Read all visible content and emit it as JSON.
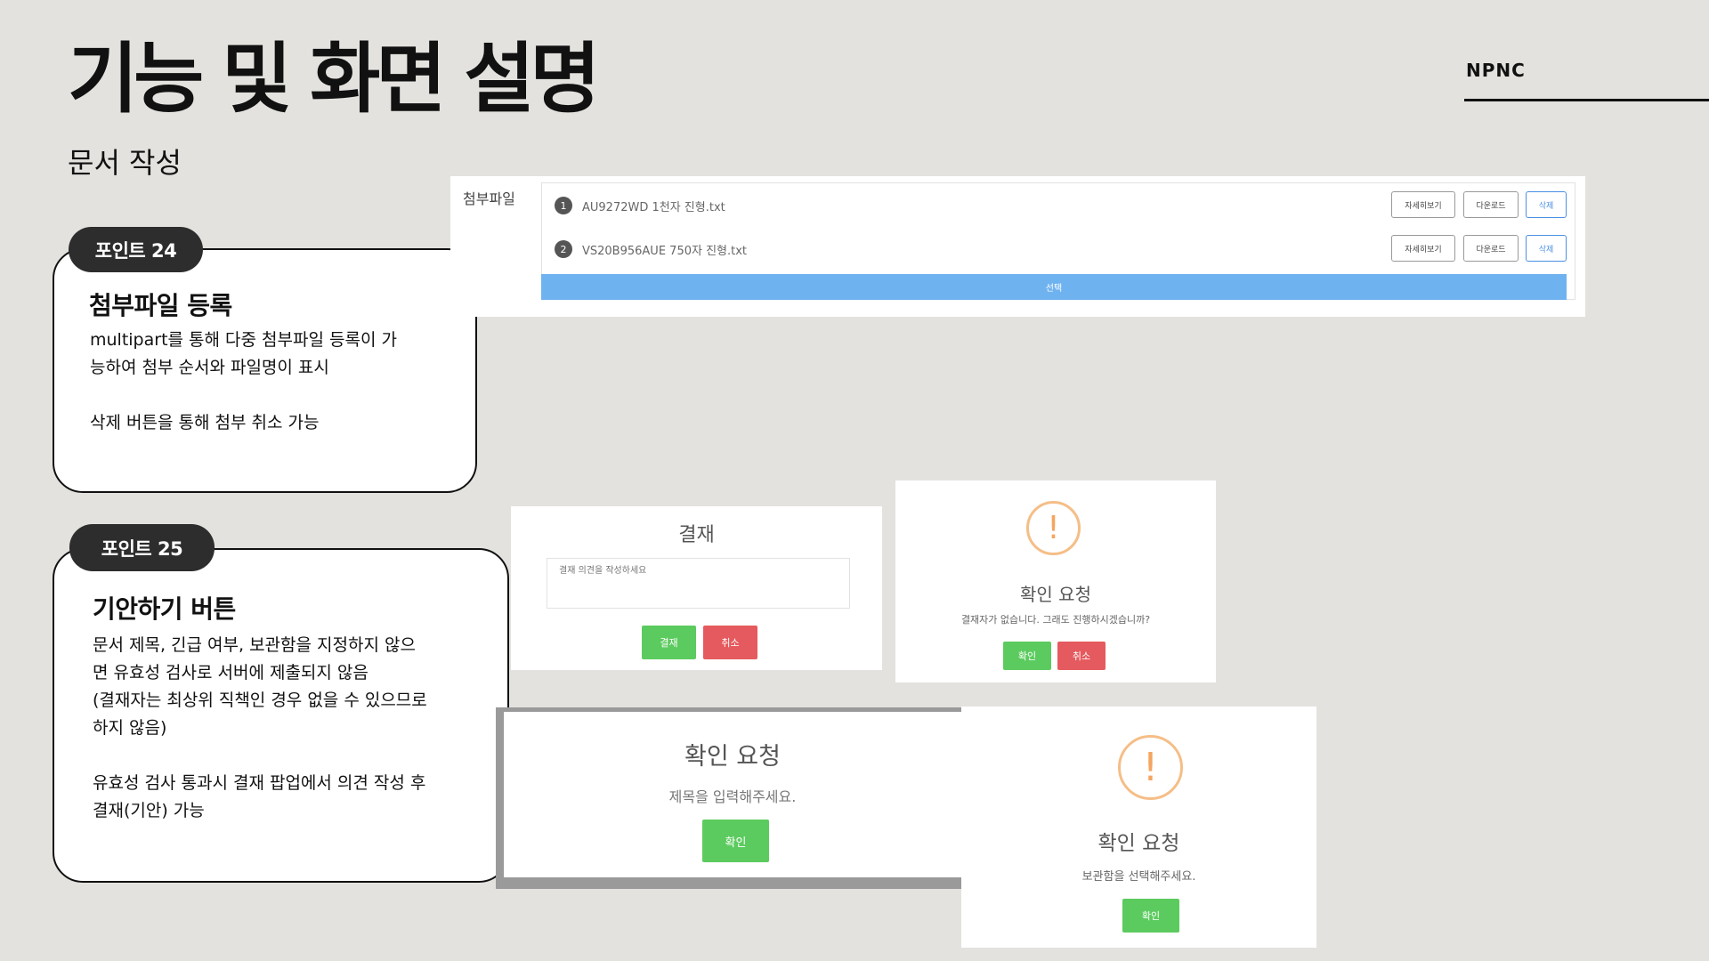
{
  "header": {
    "title": "기능 및 화면 설명",
    "subtitle": "문서 작성",
    "brand": "NPNC"
  },
  "points": [
    {
      "tag": "포인트 24",
      "title": "첨부파일 등록",
      "lines": [
        "multipart를 통해 다중 첨부파일 등록이 가",
        "능하여 첨부 순서와 파일명이 표시",
        "삭제 버튼을 통해 첨부 취소 가능"
      ]
    },
    {
      "tag": "포인트 25",
      "title": "기안하기 버튼",
      "lines": [
        "문서 제목, 긴급 여부, 보관함을 지정하지 않으",
        "면 유효성 검사로 서버에 제출되지 않음",
        "(결재자는 최상위 직책인 경우 없을 수 있으므로",
        "하지 않음)",
        "유효성 검사 통과시 결재 팝업에서 의견 작성 후",
        "결재(기안) 가능"
      ]
    }
  ],
  "attachment": {
    "label": "첨부파일",
    "files": [
      {
        "num": "1",
        "name": "AU9272WD 1천자 진형.txt"
      },
      {
        "num": "2",
        "name": "VS20B956AUE 750자 진형.txt"
      }
    ],
    "buttons": {
      "detail": "자세히보기",
      "download": "다운로드",
      "delete": "삭제"
    },
    "select_label": "선택"
  },
  "approval_dialog": {
    "title": "결재",
    "placeholder": "결재 의견을 작성하세요",
    "confirm": "결재",
    "cancel": "취소"
  },
  "confirm_no_approver": {
    "title": "확인 요청",
    "message": "결재자가 없습니다. 그래도 진행하시겠습니까?",
    "ok": "확인",
    "cancel": "취소"
  },
  "confirm_title": {
    "title": "확인 요청",
    "message": "제목을 입력해주세요.",
    "ok": "확인"
  },
  "confirm_box": {
    "title": "확인 요청",
    "message": "보관함을 선택해주세요.",
    "ok": "확인"
  },
  "icons": {
    "warning": "!"
  },
  "colors": {
    "green": "#5ccb5f",
    "red": "#e55a5e",
    "blue": "#6fb2f0",
    "warning": "#f5be87"
  }
}
